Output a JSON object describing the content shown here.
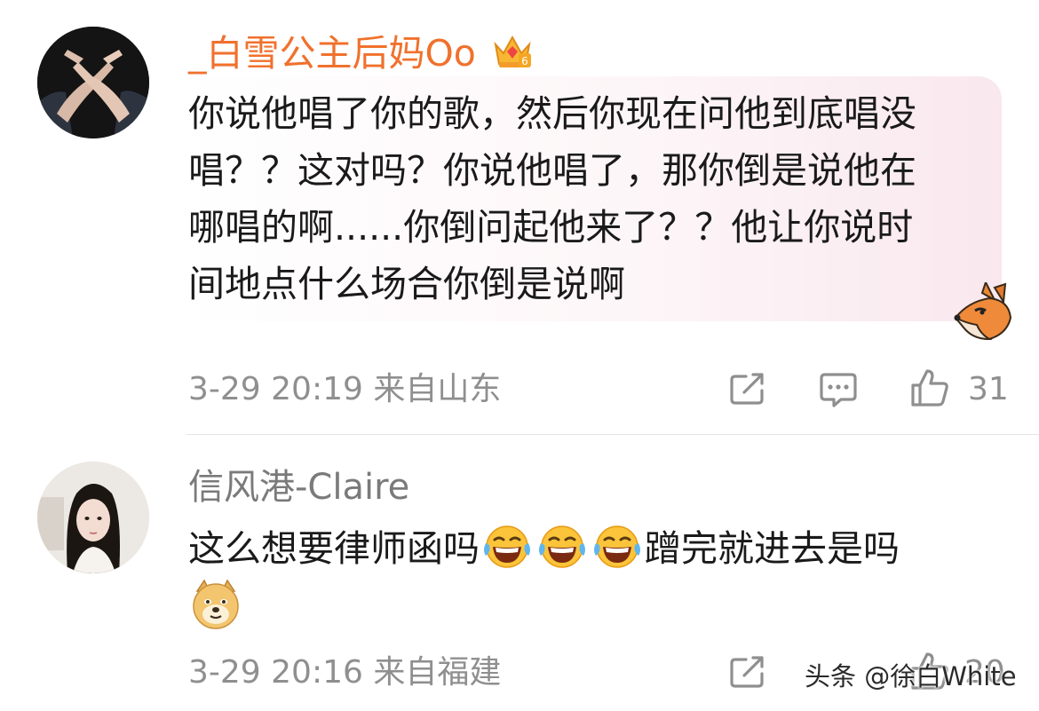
{
  "comments": [
    {
      "username": "_白雪公主后妈Oo",
      "badge": "crown-badge-icon",
      "lines": [
        "你说他唱了你的歌，然后你现在问他到底唱没",
        "唱？？这对吗？你说他唱了，那你倒是说他在",
        "哪唱的啊......你倒问起他来了？？他让你说时",
        "间地点什么场合你倒是说啊"
      ],
      "bubble_sticker": "fox-sticker-icon",
      "meta": "3-29 20:19 来自山东",
      "likes": "31"
    },
    {
      "username": "信风港-Claire",
      "line_before_emoji": "这么想要律师函吗",
      "emoji_name": "laughing-tears-emoji",
      "emoji_count": 3,
      "line_after_emoji": "蹭完就进去是吗",
      "trailing_emoji": "doge-emoji",
      "meta": "3-29 20:16 来自福建",
      "likes": "20"
    }
  ],
  "watermark": "头条 @徐白White",
  "colors": {
    "username_vip": "#f0712d",
    "username_normal": "#7a7a7a",
    "meta_gray": "#8f8f8f",
    "bubble_pink": "#f9e8ee"
  }
}
